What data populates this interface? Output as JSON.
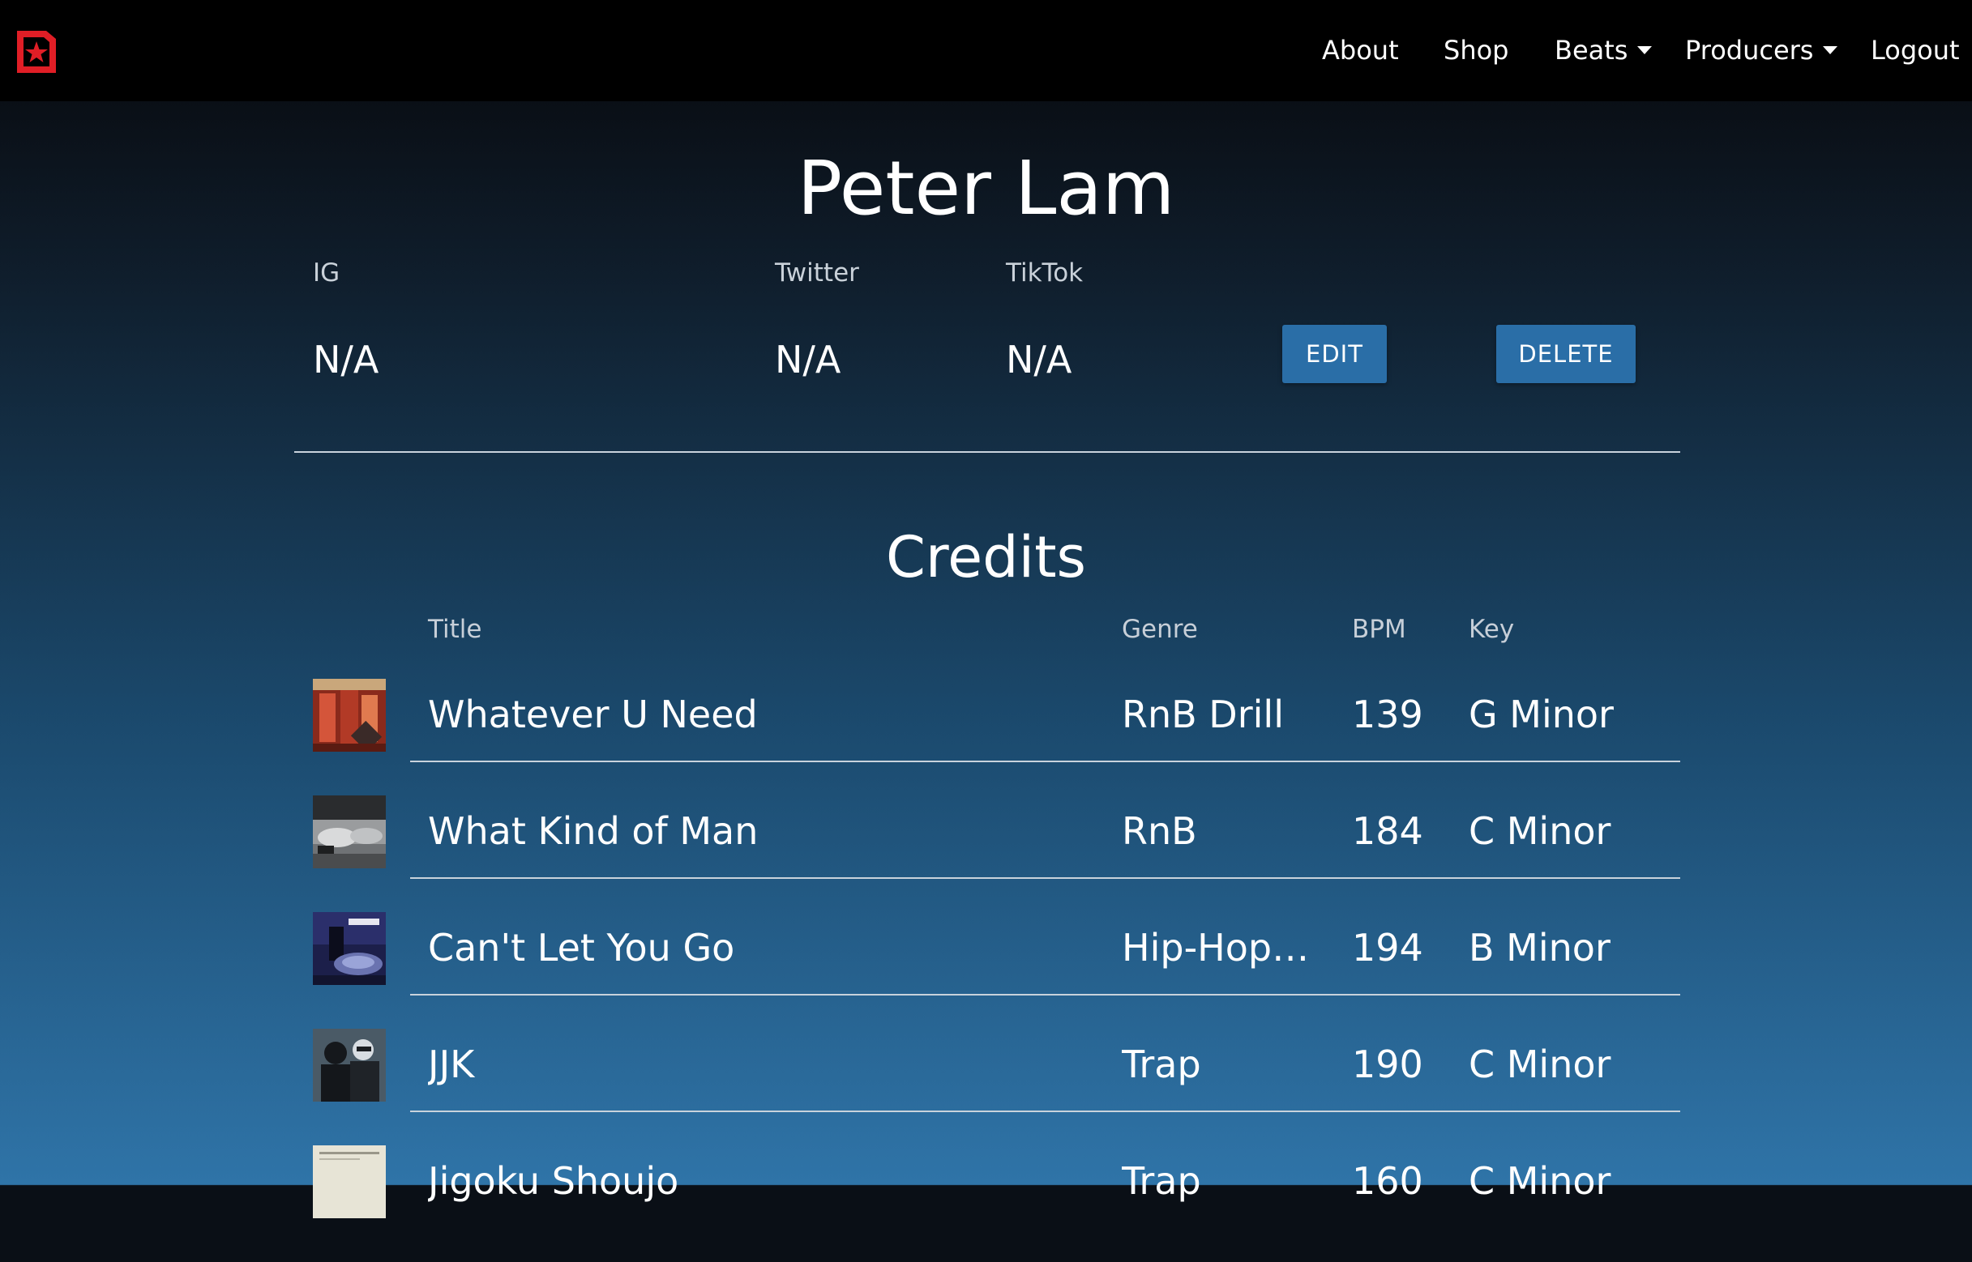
{
  "nav": {
    "logo": "beatstars-logo",
    "items": [
      {
        "label": "About",
        "has_dropdown": false
      },
      {
        "label": "Shop",
        "has_dropdown": false
      },
      {
        "label": "Beats",
        "has_dropdown": true
      },
      {
        "label": "Producers",
        "has_dropdown": true
      },
      {
        "label": "Logout",
        "has_dropdown": false
      }
    ]
  },
  "profile": {
    "name": "Peter Lam",
    "socials": [
      {
        "label": "IG",
        "value": "N/A"
      },
      {
        "label": "Twitter",
        "value": "N/A"
      },
      {
        "label": "TikTok",
        "value": "N/A"
      }
    ],
    "edit_label": "EDIT",
    "delete_label": "DELETE"
  },
  "credits": {
    "heading": "Credits",
    "columns": [
      "Title",
      "Genre",
      "BPM",
      "Key"
    ],
    "rows": [
      {
        "title": "Whatever U Need",
        "genre": "RnB Drill",
        "bpm": "139",
        "key": "G Minor"
      },
      {
        "title": "What Kind of Man",
        "genre": "RnB",
        "bpm": "184",
        "key": "C Minor"
      },
      {
        "title": "Can't Let You Go",
        "genre": "Hip-Hop/...",
        "bpm": "194",
        "key": "B Minor"
      },
      {
        "title": "JJK",
        "genre": "Trap",
        "bpm": "190",
        "key": "C Minor"
      },
      {
        "title": "Jigoku Shoujo",
        "genre": "Trap",
        "bpm": "160",
        "key": "C Minor"
      }
    ]
  },
  "colors": {
    "accent_button": "#2a6ea7",
    "logo_red": "#e01e26",
    "nav_background": "#000000"
  }
}
